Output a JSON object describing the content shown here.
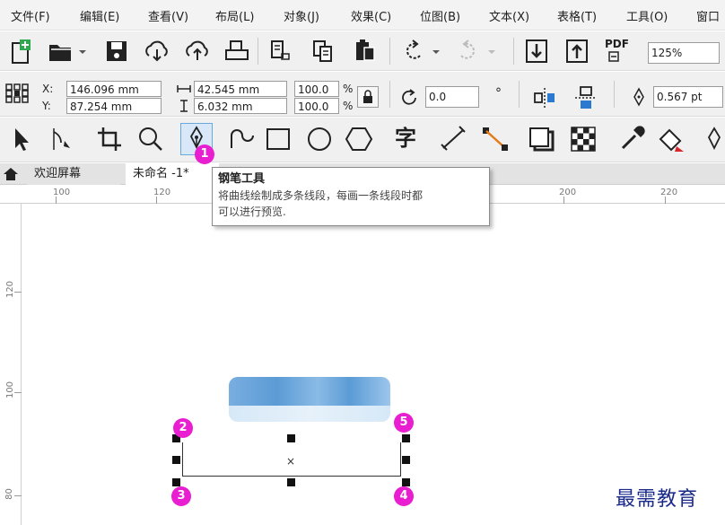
{
  "menubar": {
    "items": [
      "文件(F)",
      "编辑(E)",
      "查看(V)",
      "布局(L)",
      "对象(J)",
      "效果(C)",
      "位图(B)",
      "文本(X)",
      "表格(T)",
      "工具(O)",
      "窗口"
    ]
  },
  "standard_toolbar": {
    "pdf_label": "PDF",
    "zoom_value": "125%"
  },
  "property_bar": {
    "x_label": "X:",
    "y_label": "Y:",
    "x_value": "146.096 mm",
    "y_value": "87.254 mm",
    "width_value": "42.545 mm",
    "height_value": "6.032 mm",
    "scale_x_value": "100.0",
    "scale_y_value": "100.0",
    "percent": "%",
    "rotation_value": "0.0",
    "degree_symbol": "°",
    "outline_width_value": "0.567 pt"
  },
  "toolbox": {
    "text_tool_glyph": "字"
  },
  "tabs": {
    "welcome": "欢迎屏幕",
    "document": "未命名 -1*"
  },
  "rulers": {
    "horizontal_labels": [
      "100",
      "120",
      "200",
      "220"
    ],
    "vertical_labels": [
      "120",
      "100",
      "80"
    ]
  },
  "tooltip": {
    "title": "钢笔工具",
    "line1": "将曲线绘制成多条线段，每画一条线段时都",
    "line2": "可以进行预览."
  },
  "annotations": {
    "n1": "1",
    "n2": "2",
    "n3": "3",
    "n4": "4",
    "n5": "5"
  },
  "watermark": "最需教育",
  "colors": {
    "badge": "#e81ed0",
    "selection_handle": "#111111",
    "blurred_text": "#5b9bd5",
    "watermark": "#1a2a8a"
  }
}
